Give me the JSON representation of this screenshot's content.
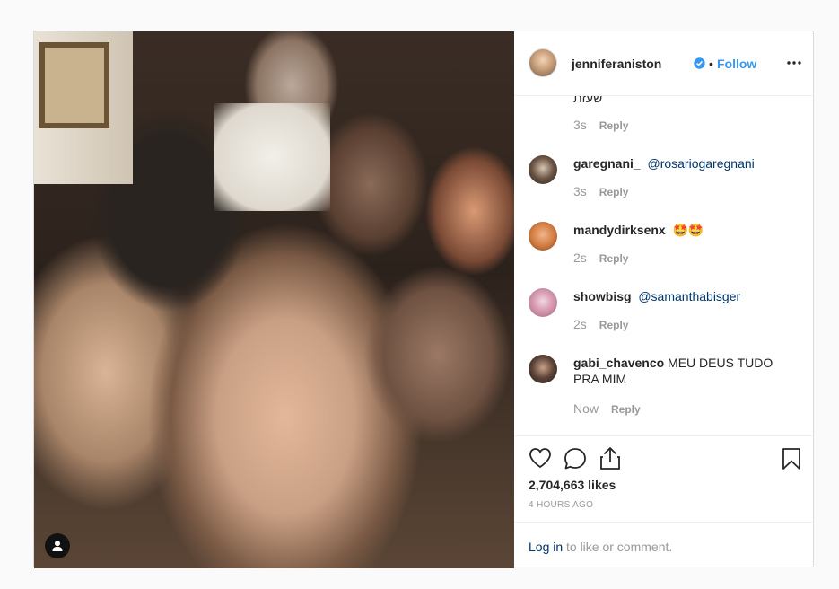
{
  "header": {
    "username": "jenniferaniston",
    "dot": "•",
    "follow_label": "Follow",
    "more_icon": "more-horizontal-icon",
    "verified_icon": "verified-badge-icon",
    "accent": "#3897f0"
  },
  "comments": {
    "cut_text": "שעזת",
    "cut_time": "3s",
    "items": [
      {
        "user": "garegnani_",
        "text": "@rosariogaregnani",
        "time": "3s",
        "reply": "Reply"
      },
      {
        "user": "mandydirksenx",
        "text": "🤩🤩",
        "time": "2s",
        "reply": "Reply"
      },
      {
        "user": "showbisg",
        "text": "@samanthabisger",
        "time": "2s",
        "reply": "Reply"
      },
      {
        "user": "gabi_chavenco",
        "text": "MEU DEUS TUDO PRA MIM",
        "time": "Now",
        "reply": "Reply"
      }
    ],
    "cut_reply": "Reply"
  },
  "actions": {
    "likes": "2,704,663 likes",
    "time_ago": "4 HOURS AGO",
    "login_link": "Log in",
    "login_rest": "to like or comment."
  },
  "photo": {
    "user_tag_icon": "user-tag-icon"
  }
}
